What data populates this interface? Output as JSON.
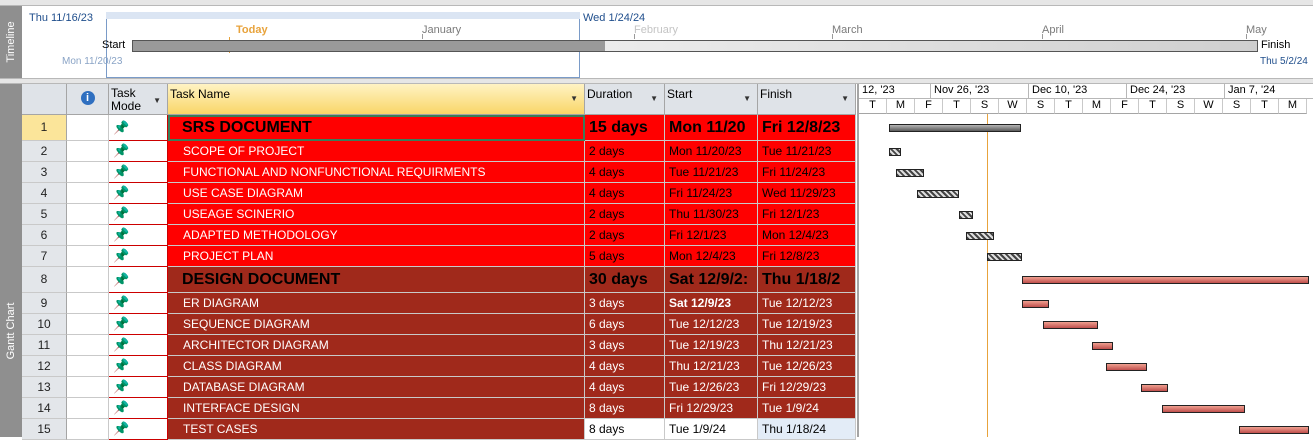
{
  "timeline": {
    "side_label": "Timeline",
    "start_date": "Thu 11/16/23",
    "end_visible_date": "Wed 1/24/24",
    "today_label": "Today",
    "months": [
      "January",
      "February",
      "March",
      "April",
      "May"
    ],
    "start_label": "Start",
    "finish_label": "Finish",
    "project_start": "Mon 11/20/23",
    "project_finish": "Thu 5/2/24"
  },
  "view": {
    "side_label": "Gantt Chart"
  },
  "columns": {
    "info_icon": "i",
    "task_mode": "Task Mode",
    "task_name": "Task Name",
    "duration": "Duration",
    "start": "Start",
    "finish": "Finish"
  },
  "tasks": [
    {
      "id": "1",
      "name": "SRS DOCUMENT",
      "duration": "15 days",
      "start": "Mon 11/20",
      "finish": "Fri 12/8/23",
      "summary": true
    },
    {
      "id": "2",
      "name": "SCOPE OF PROJECT",
      "duration": "2 days",
      "start": "Mon 11/20/23",
      "finish": "Tue 11/21/23"
    },
    {
      "id": "3",
      "name": "FUNCTIONAL AND NONFUNCTIONAL REQUIRMENTS",
      "duration": "4 days",
      "start": "Tue 11/21/23",
      "finish": "Fri 11/24/23"
    },
    {
      "id": "4",
      "name": "USE CASE DIAGRAM",
      "duration": "4 days",
      "start": "Fri 11/24/23",
      "finish": "Wed 11/29/23"
    },
    {
      "id": "5",
      "name": "USEAGE SCINERIO",
      "duration": "2 days",
      "start": "Thu 11/30/23",
      "finish": "Fri 12/1/23"
    },
    {
      "id": "6",
      "name": "ADAPTED METHODOLOGY",
      "duration": "2 days",
      "start": "Fri 12/1/23",
      "finish": "Mon 12/4/23"
    },
    {
      "id": "7",
      "name": "PROJECT PLAN",
      "duration": "5 days",
      "start": "Mon 12/4/23",
      "finish": "Fri 12/8/23"
    },
    {
      "id": "8",
      "name": "DESIGN DOCUMENT",
      "duration": "30 days",
      "start": "Sat 12/9/2:",
      "finish": "Thu 1/18/2",
      "summary": true
    },
    {
      "id": "9",
      "name": "ER DIAGRAM",
      "duration": "3 days",
      "start": "Sat 12/9/23",
      "finish": "Tue 12/12/23"
    },
    {
      "id": "10",
      "name": "SEQUENCE DIAGRAM",
      "duration": "6 days",
      "start": "Tue 12/12/23",
      "finish": "Tue 12/19/23"
    },
    {
      "id": "11",
      "name": "ARCHITECTOR DIAGRAM",
      "duration": "3 days",
      "start": "Tue 12/19/23",
      "finish": "Thu 12/21/23"
    },
    {
      "id": "12",
      "name": "CLASS DIAGRAM",
      "duration": "4 days",
      "start": "Thu 12/21/23",
      "finish": "Tue 12/26/23"
    },
    {
      "id": "13",
      "name": "DATABASE DIAGRAM",
      "duration": "4 days",
      "start": "Tue 12/26/23",
      "finish": "Fri 12/29/23"
    },
    {
      "id": "14",
      "name": "INTERFACE DESIGN",
      "duration": "8 days",
      "start": "Fri 12/29/23",
      "finish": "Tue 1/9/24"
    },
    {
      "id": "15",
      "name": "TEST CASES",
      "duration": "8 days",
      "start": "Tue 1/9/24",
      "finish": "Thu 1/18/24"
    }
  ],
  "gantt": {
    "weeks": [
      "12, '23",
      "Nov 26, '23",
      "Dec 10, '23",
      "Dec 24, '23",
      "Jan 7, '24"
    ],
    "days": [
      "T",
      "M",
      "F",
      "T",
      "S",
      "W",
      "S",
      "T",
      "M",
      "F",
      "T",
      "S",
      "W",
      "S",
      "T",
      "M"
    ]
  },
  "colors": {
    "group1": "#ff0000",
    "group2": "#a0291b",
    "today_line": "#e8a33c",
    "selected_row": "#fbe59a"
  }
}
